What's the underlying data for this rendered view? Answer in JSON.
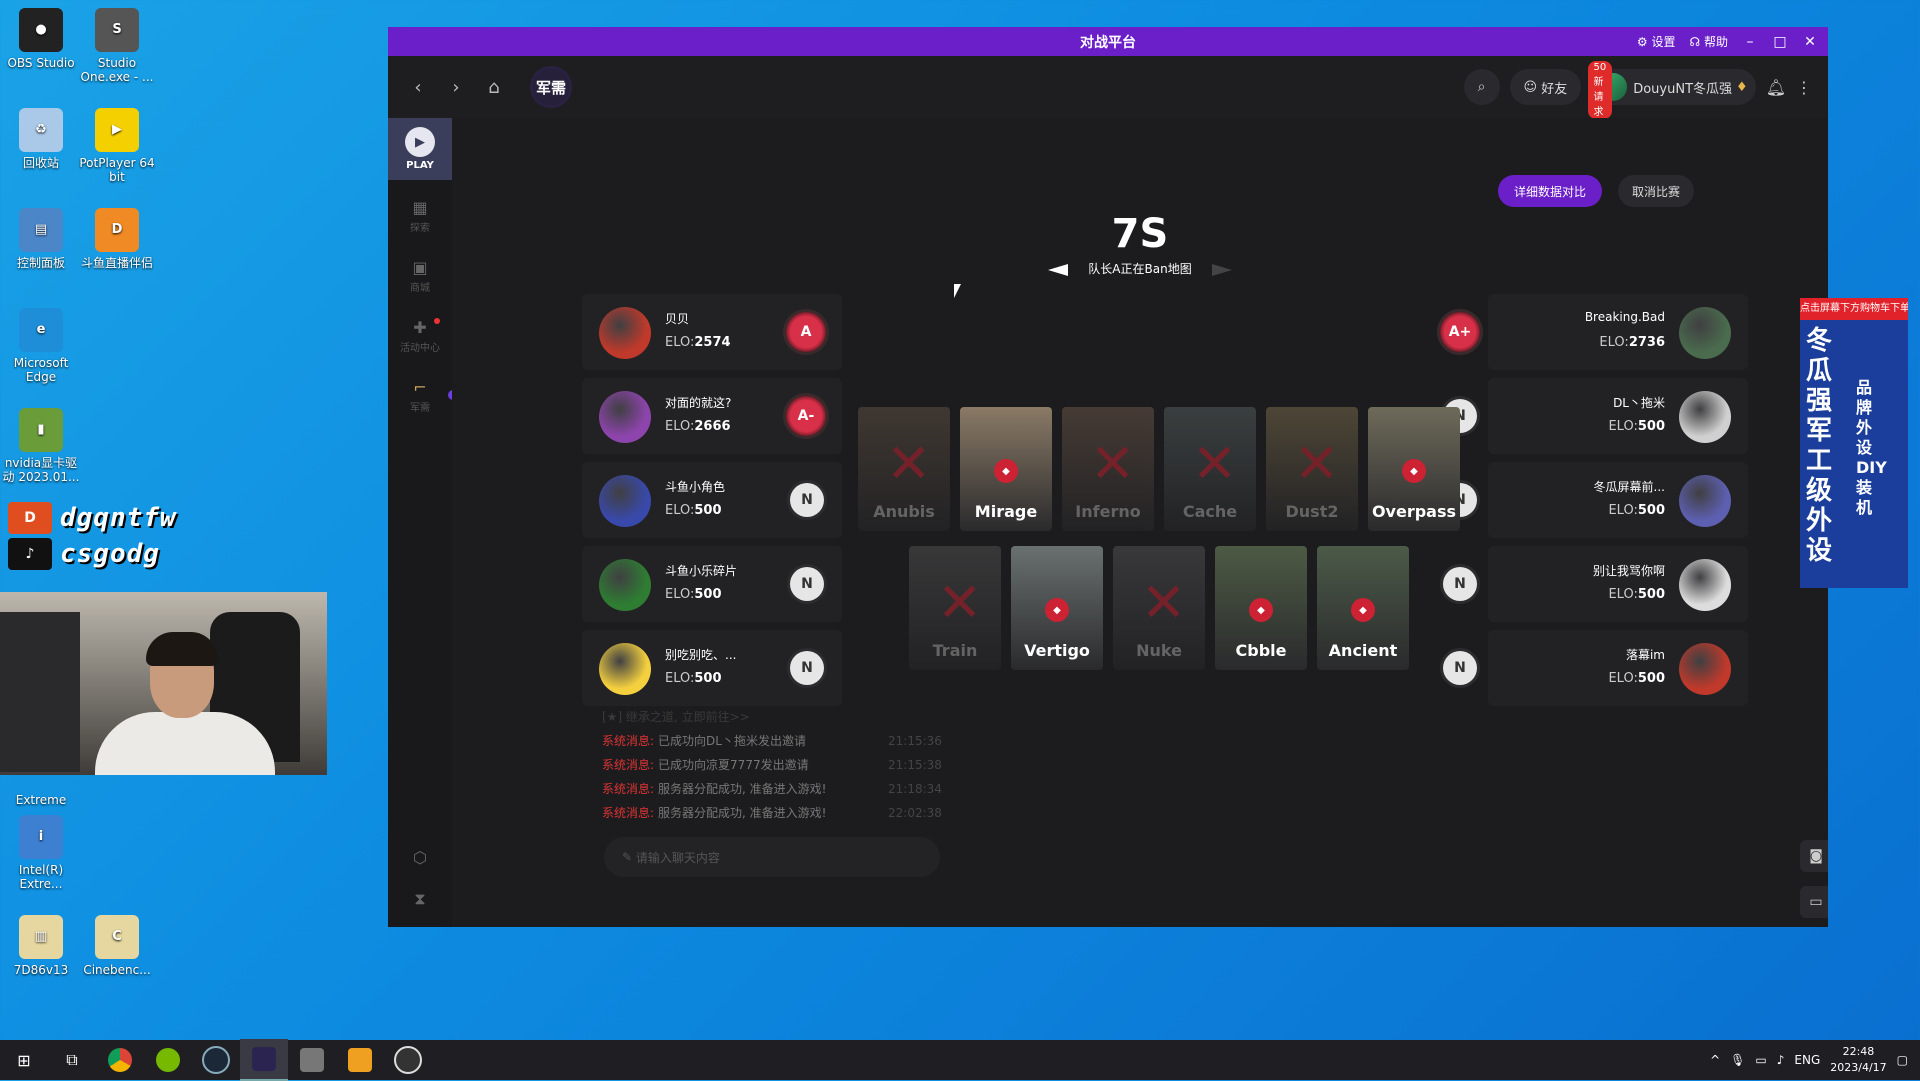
{
  "desktop": {
    "icons": [
      {
        "label": "OBS Studio",
        "glyph": "●"
      },
      {
        "label": "Studio One.exe - ...",
        "glyph": "S"
      },
      {
        "label": "回收站",
        "glyph": "♻"
      },
      {
        "label": "PotPlayer 64 bit",
        "glyph": "▶"
      },
      {
        "label": "控制面板",
        "glyph": "▤"
      },
      {
        "label": "斗鱼直播伴侣",
        "glyph": "D"
      },
      {
        "label": "Microsoft Edge",
        "glyph": "e"
      },
      {
        "label": "nvidia显卡驱动 2023.01...",
        "glyph": "▮"
      },
      {
        "label": "Extreme",
        "glyph": ""
      },
      {
        "label": "Intel(R) Extre...",
        "glyph": "i"
      },
      {
        "label": "7D86v13",
        "glyph": "▥"
      },
      {
        "label": "Cinebenc...",
        "glyph": "C"
      }
    ]
  },
  "overlay": {
    "tag1": "dgqntfw",
    "tag2": "csgodg"
  },
  "app": {
    "brand": "对战平台",
    "settings": "设置",
    "help": "帮助",
    "tab": "军需",
    "friends": "好友",
    "requests_badge": "50新请求",
    "username": "DouyuNT冬瓜强",
    "sidebar": {
      "play": "PLAY",
      "items": [
        "探索",
        "商城",
        "活动中心",
        "军需"
      ]
    },
    "buttons": {
      "compare": "详细数据对比",
      "cancel": "取消比赛"
    },
    "timer": "7S",
    "ban_status": "队长A正在Ban地图",
    "team_a": [
      {
        "name": "贝贝",
        "elo_label": "ELO:",
        "elo": "2574",
        "rank": "A",
        "avatar_color": "#c0392b"
      },
      {
        "name": "对面的就这?",
        "elo_label": "ELO:",
        "elo": "2666",
        "rank": "A-",
        "avatar_color": "#8e44ad"
      },
      {
        "name": "斗鱼小角色",
        "elo_label": "ELO:",
        "elo": "500",
        "rank": "N",
        "avatar_color": "#3949ab"
      },
      {
        "name": "斗鱼小乐碎片",
        "elo_label": "ELO:",
        "elo": "500",
        "rank": "N",
        "avatar_color": "#2e7d32"
      },
      {
        "name": "别吃别吃、...",
        "elo_label": "ELO:",
        "elo": "500",
        "rank": "N",
        "avatar_color": "#f4d03f"
      }
    ],
    "team_b": [
      {
        "name": "Breaking.Bad",
        "elo_label": "ELO:",
        "elo": "2736",
        "rank": "A+",
        "avatar_color": "#4a6b4d"
      },
      {
        "name": "DL丶拖米",
        "elo_label": "ELO:",
        "elo": "500",
        "rank": "N",
        "avatar_color": "#d0d0d0"
      },
      {
        "name": "冬瓜屏幕前...",
        "elo_label": "ELO:",
        "elo": "500",
        "rank": "N",
        "avatar_color": "#5d5fb0"
      },
      {
        "name": "别让我骂你啊",
        "elo_label": "ELO:",
        "elo": "500",
        "rank": "N",
        "avatar_color": "#dddddd"
      },
      {
        "name": "落幕im",
        "elo_label": "ELO:",
        "elo": "500",
        "rank": "N",
        "avatar_color": "#c0392b"
      }
    ],
    "maps_row1": [
      {
        "name": "Anubis",
        "banned": true,
        "color": "#6b5a4a"
      },
      {
        "name": "Mirage",
        "banned": false,
        "color": "#8a7a66"
      },
      {
        "name": "Inferno",
        "banned": true,
        "color": "#7a6050"
      },
      {
        "name": "Cache",
        "banned": true,
        "color": "#5f6a6a"
      },
      {
        "name": "Dust2",
        "banned": true,
        "color": "#8b7a55"
      },
      {
        "name": "Overpass",
        "banned": false,
        "color": "#6e6a5a"
      }
    ],
    "maps_row2": [
      {
        "name": "Train",
        "banned": true,
        "color": "#5a5a5a"
      },
      {
        "name": "Vertigo",
        "banned": false,
        "color": "#6a7070"
      },
      {
        "name": "Nuke",
        "banned": true,
        "color": "#5c5c60"
      },
      {
        "name": "Cbble",
        "banned": false,
        "color": "#4d5a44"
      },
      {
        "name": "Ancient",
        "banned": false,
        "color": "#4c5a48"
      }
    ],
    "chat": {
      "faded_line": "[★] 继承之道, 立即前往>>",
      "messages": [
        {
          "sys": "系统消息:",
          "text": "已成功向DL丶拖米发出邀请",
          "time": "21:15:36"
        },
        {
          "sys": "系统消息:",
          "text": "已成功向凉夏7777发出邀请",
          "time": "21:15:38"
        },
        {
          "sys": "系统消息:",
          "text": "服务器分配成功, 准备进入游戏!",
          "time": "21:18:34"
        },
        {
          "sys": "系统消息:",
          "text": "服务器分配成功, 准备进入游戏!",
          "time": "22:02:38"
        }
      ],
      "placeholder": "请输入聊天内容"
    }
  },
  "ad": {
    "top": "点击屏幕下方购物车下单",
    "big": "冬瓜强军工级外设",
    "small": "品牌外设DIY装机"
  },
  "taskbar": {
    "lang": "ENG",
    "time": "22:48",
    "date": "2023/4/17"
  }
}
